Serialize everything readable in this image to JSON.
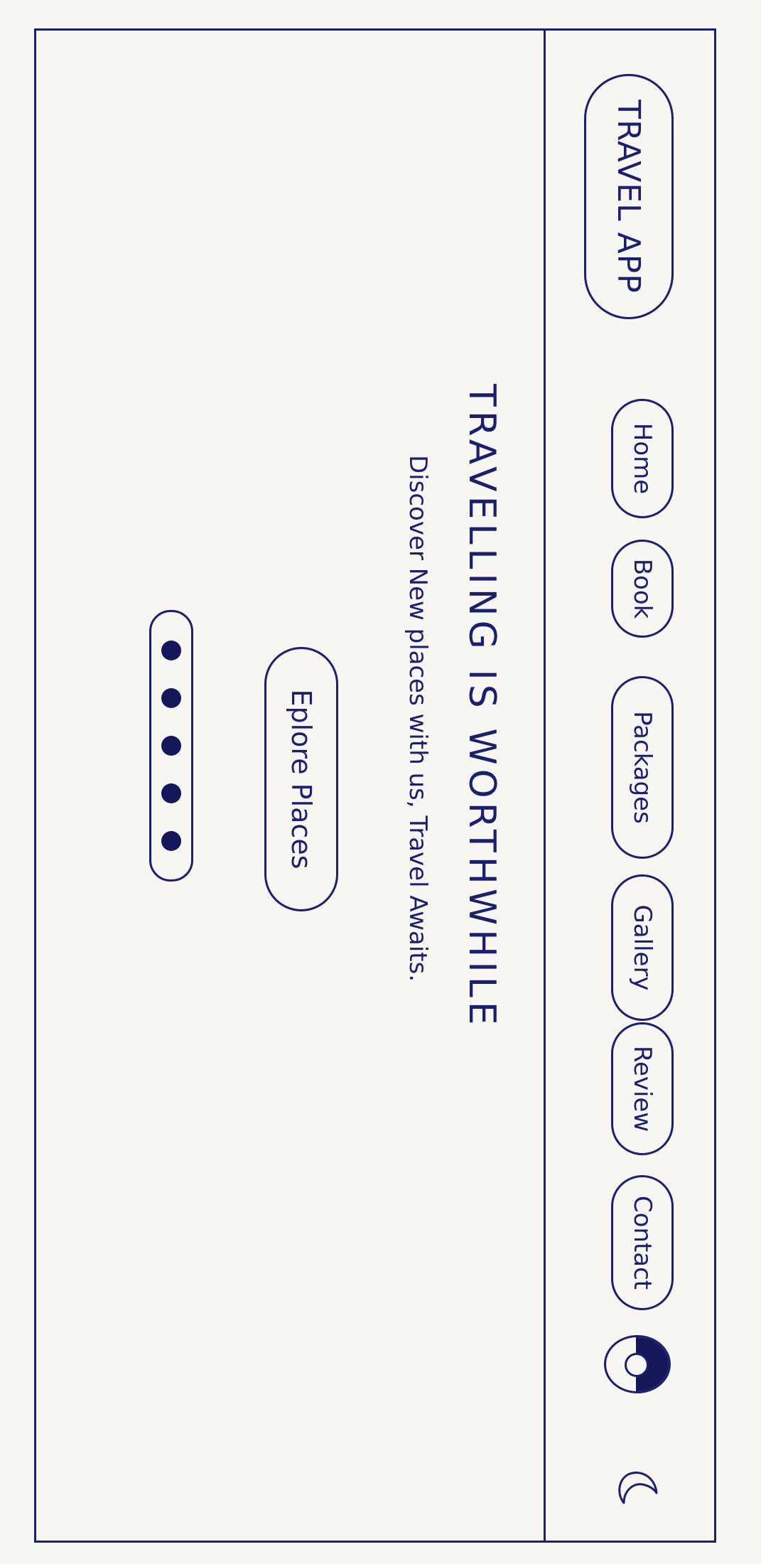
{
  "app": {
    "logo_text": "TRAVEL APP"
  },
  "nav": {
    "items": [
      {
        "label": "Home"
      },
      {
        "label": "Book"
      },
      {
        "label": "Packages"
      },
      {
        "label": "Gallery"
      },
      {
        "label": "Review"
      },
      {
        "label": "Contact"
      }
    ],
    "profile_icon": "user-profile-icon",
    "theme_icon": "moon-icon"
  },
  "hero": {
    "title": "TRAVELLING IS WORTHWHILE",
    "subtitle": "Discover New places with us, Travel Awaits.",
    "cta_label": "Eplore Places"
  },
  "carousel": {
    "dot_count": 5
  },
  "colors": {
    "ink": "#1a1f6e",
    "paper": "#f7f6f2"
  }
}
